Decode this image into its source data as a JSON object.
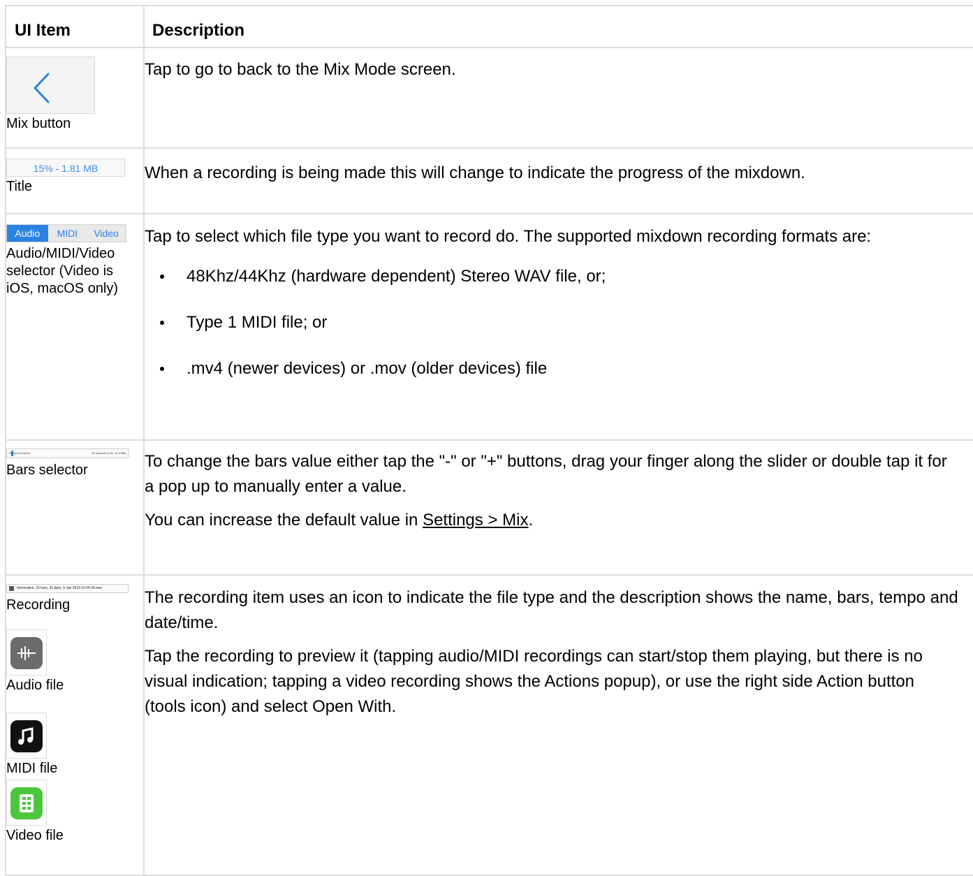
{
  "table": {
    "header": {
      "col1": "UI Item",
      "col2": "Description"
    },
    "rows": {
      "mix": {
        "label": "Mix button",
        "desc": "Tap to go to back to the Mix Mode screen."
      },
      "title": {
        "preview_text": "15% - 1.81 MB",
        "label": "Title",
        "desc": "When a recording is being made this will change to indicate the progress of the mixdown."
      },
      "selector": {
        "seg_options": [
          "Audio",
          "MIDI",
          "Video"
        ],
        "selected": "Audio",
        "label": "Audio/MIDI/Video selector (Video is iOS, macOS only)",
        "desc": "Tap to select which file type you want to record do. The supported mixdown recording formats are:",
        "formats": [
          "48Khz/44Khz (hardware dependent) Stereo WAV file, or;",
          "Type 1 MIDI file; or",
          ".mv4 (newer devices) or .mov (older devices) file"
        ]
      },
      "bars": {
        "preview_left": "Record Seconds",
        "preview_right": "60 seconds (1:00, 11.5 MB)",
        "label": "Bars selector",
        "desc1": "To change the bars value either tap the \"-\" or \"+\" buttons, drag your finger along the slider or double tap it for a pop up to manually enter a value.",
        "desc2_prefix": "You can increase the default value in ",
        "desc2_link": "Settings > Mix",
        "desc2_suffix": "."
      },
      "recording": {
        "preview_text": "Generative, 20 bars, 31 bpm, 9 Jan 2019 14 04 09.wav",
        "label": "Recording",
        "audio_label": "Audio file",
        "midi_label": "MIDI file",
        "video_label": "Video file",
        "desc1": "The recording item uses an icon to indicate the file type and the description shows the name, bars, tempo and date/time.",
        "desc2": "Tap the recording to preview it (tapping audio/MIDI recordings can start/stop them playing, but there is no visual indication; tapping a video recording shows the Actions popup), or use the right side Action button (tools icon) and select Open With."
      }
    }
  },
  "colors": {
    "accent_blue": "#2a82e4",
    "border": "#dcdcdc",
    "audio_icon": "#6b6b6b",
    "midi_icon": "#111111",
    "video_icon": "#4cc63c"
  },
  "icons": [
    "chevron-left-icon",
    "audio-file-icon",
    "midi-file-icon",
    "video-file-icon"
  ]
}
